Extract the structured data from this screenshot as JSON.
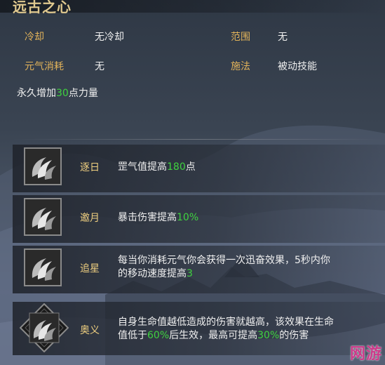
{
  "title": "远古之心",
  "stats": {
    "cooldown_label": "冷却",
    "cooldown_value": "无冷却",
    "range_label": "范围",
    "range_value": "无",
    "cost_label": "元气消耗",
    "cost_value": "无",
    "cast_label": "施法",
    "cast_value": "被动技能"
  },
  "description": {
    "pre": "永久增加",
    "num": "30",
    "post": "点力量"
  },
  "skills": [
    {
      "name": "逐日",
      "line1_pre": "罡气值提高",
      "line1_num": "180",
      "line1_post": "点"
    },
    {
      "name": "邀月",
      "line1_pre": "暴击伤害提高",
      "line1_num": "10%",
      "line1_post": ""
    },
    {
      "name": "追星",
      "line1_pre": "每当你消耗元气你会获得一次迅奋效果，5秒内你",
      "line2_pre": "的移动速度提高",
      "line2_num": "3"
    },
    {
      "name": "奥义",
      "line1_pre": "自身生命值越低造成的伤害就越高，该效果在生命",
      "line2_pre": "值低于",
      "line2_num": "60%",
      "line2_mid": "后生效，最高可提高",
      "line2_num2": "30%",
      "line2_post": "的伤害"
    }
  ],
  "watermark": "网游"
}
